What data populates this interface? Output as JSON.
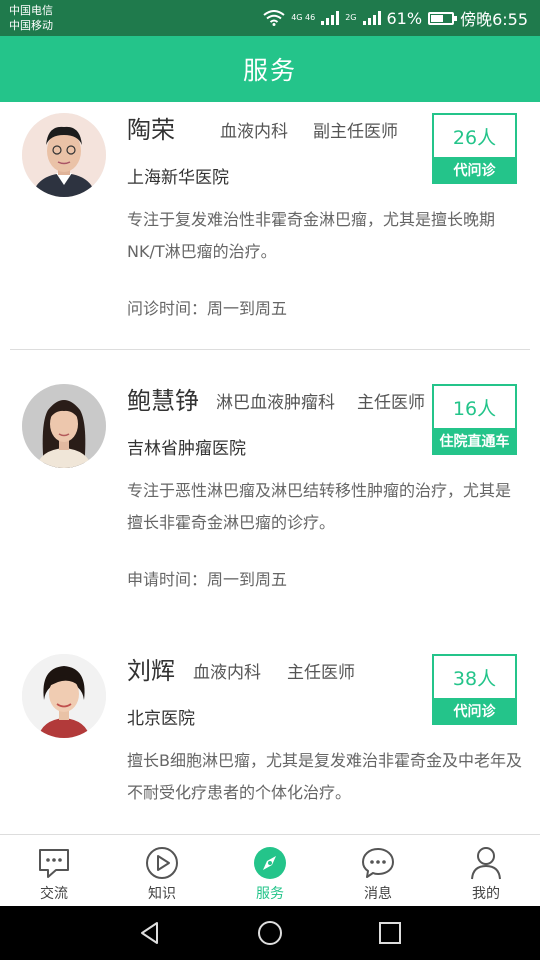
{
  "status_bar": {
    "carrier_1": "中国电信",
    "carrier_2": "中国移动",
    "net_1": "4G 46",
    "net_2": "2G",
    "battery_percent": "61%",
    "battery_level": 0.61,
    "time": "傍晚6:55"
  },
  "header": {
    "title": "服务"
  },
  "doctors": [
    {
      "name": "陶荣",
      "department": "血液内科",
      "title": "副主任医师",
      "hospital": "上海新华医院",
      "description": "专注于复发难治性非霍奇金淋巴瘤，尤其是擅长晚期NK/T淋巴瘤的治疗。",
      "time_text": "问诊时间：周一到周五",
      "count": "26人",
      "tag": "代问诊"
    },
    {
      "name": "鲍慧铮",
      "department": "淋巴血液肿瘤科",
      "title": "主任医师",
      "hospital": "吉林省肿瘤医院",
      "description": "专注于恶性淋巴瘤及淋巴结转移性肿瘤的治疗，尤其是擅长非霍奇金淋巴瘤的诊疗。",
      "time_text": "申请时间：周一到周五",
      "count": "16人",
      "tag": "住院直通车"
    },
    {
      "name": "刘辉",
      "department": "血液内科",
      "title": "主任医师",
      "hospital": "北京医院",
      "description": "擅长B细胞淋巴瘤，尤其是复发难治非霍奇金及中老年及不耐受化疗患者的个体化治疗。",
      "count": "38人",
      "tag": "代问诊"
    }
  ],
  "tabs": [
    {
      "label": "交流",
      "icon": "chat-bubble-icon"
    },
    {
      "label": "知识",
      "icon": "play-icon"
    },
    {
      "label": "服务",
      "icon": "compass-icon",
      "active": true
    },
    {
      "label": "消息",
      "icon": "message-icon"
    },
    {
      "label": "我的",
      "icon": "person-icon"
    }
  ],
  "colors": {
    "accent": "#24c48a",
    "status_bar": "#1f7a4c"
  }
}
